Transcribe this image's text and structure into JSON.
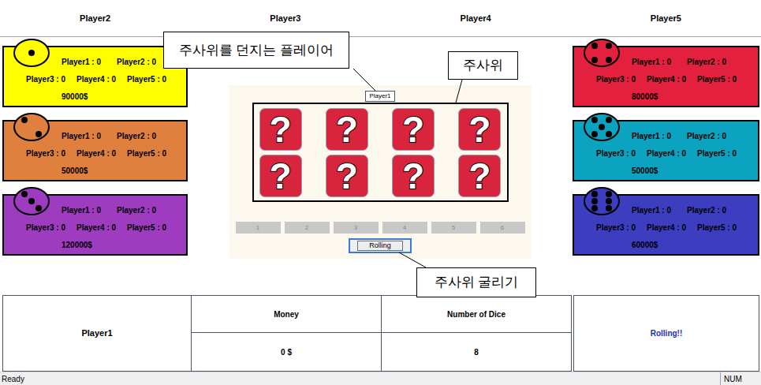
{
  "top_players": [
    "Player2",
    "Player3",
    "Player4",
    "Player5"
  ],
  "left_cards": [
    {
      "color": "#fefe00",
      "pips": 1,
      "scores": [
        "Player1 : 0",
        "Player2 : 0",
        "Player3 : 0",
        "Player4 : 0",
        "Player5 : 0"
      ],
      "money": "90000$"
    },
    {
      "color": "#e0803f",
      "pips": 2,
      "scores": [
        "Player1 : 0",
        "Player2 : 0",
        "Player3 : 0",
        "Player4 : 0",
        "Player5 : 0"
      ],
      "money": "50000$"
    },
    {
      "color": "#9e3cbf",
      "pips": 3,
      "scores": [
        "Player1 : 0",
        "Player2 : 0",
        "Player3 : 0",
        "Player4 : 0",
        "Player5 : 0"
      ],
      "money": "120000$"
    }
  ],
  "right_cards": [
    {
      "color": "#e3213f",
      "pips": 4,
      "scores": [
        "Player1 : 0",
        "Player2 : 0",
        "Player3 : 0",
        "Player4 : 0",
        "Player5 : 0"
      ],
      "money": "80000$"
    },
    {
      "color": "#0ba3bf",
      "pips": 5,
      "scores": [
        "Player1 : 0",
        "Player2 : 0",
        "Player3 : 0",
        "Player4 : 0",
        "Player5 : 0"
      ],
      "money": "50000$"
    },
    {
      "color": "#3d3dbf",
      "pips": 6,
      "scores": [
        "Player1 : 0",
        "Player2 : 0",
        "Player3 : 0",
        "Player4 : 0",
        "Player5 : 0"
      ],
      "money": "60000$"
    }
  ],
  "center": {
    "thrower": "Player1",
    "dice": [
      {
        "face": "?"
      },
      {
        "face": "?"
      },
      {
        "face": "?"
      },
      {
        "face": "?"
      },
      {
        "face": "?"
      },
      {
        "face": "?"
      },
      {
        "face": "?"
      },
      {
        "face": "?"
      }
    ],
    "number_buttons": [
      {
        "label": "1",
        "disabled": true
      },
      {
        "label": "2",
        "disabled": true
      },
      {
        "label": "3",
        "disabled": true
      },
      {
        "label": "4",
        "disabled": true
      },
      {
        "label": "5",
        "disabled": true
      },
      {
        "label": "6",
        "disabled": true
      }
    ],
    "roll_button": "Rolling"
  },
  "annotations": [
    {
      "text": "주사위를 던지는 플레이어"
    },
    {
      "text": "주사위"
    },
    {
      "text": "주사위 굴리기"
    }
  ],
  "bottom": {
    "player": "Player1",
    "columns": [
      {
        "header": "Money",
        "value": "0 $"
      },
      {
        "header": "Number of Dice",
        "value": "8"
      }
    ],
    "message": "Rolling!!"
  },
  "status_bar": {
    "left": "Ready",
    "right": "NUM"
  }
}
